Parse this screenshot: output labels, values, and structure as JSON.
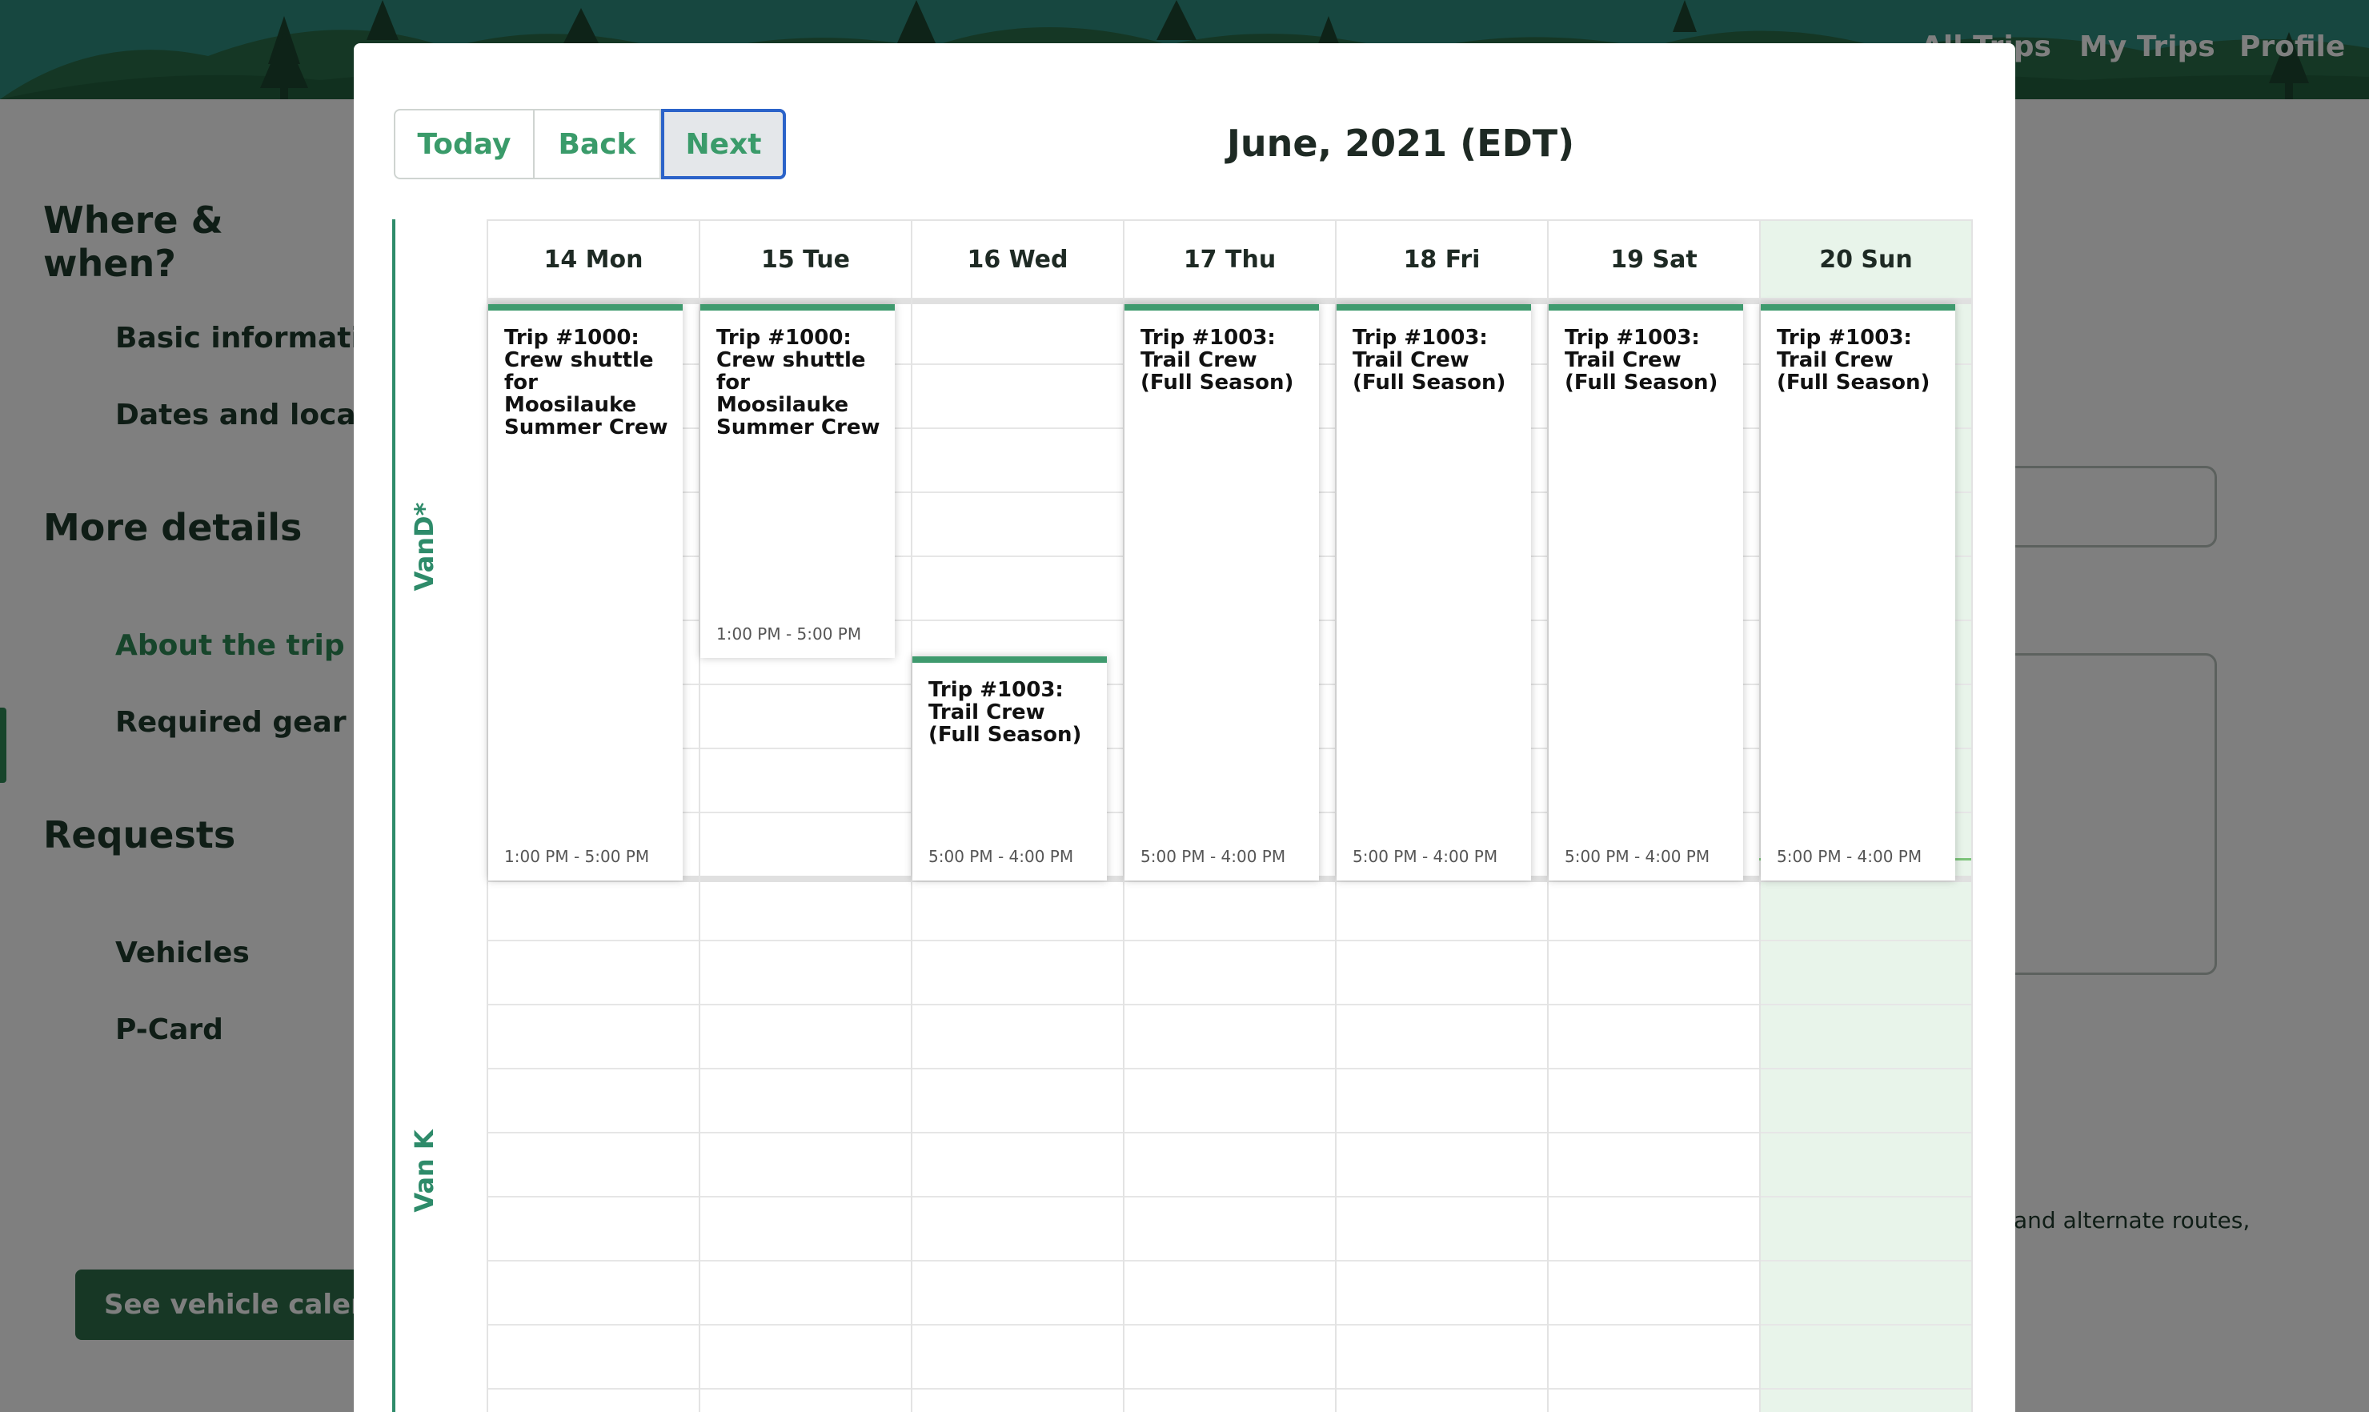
{
  "nav": {
    "items": [
      "All Trips",
      "My Trips",
      "Profile"
    ]
  },
  "sidebar": {
    "sections": [
      {
        "title": "Where & when?",
        "items": [
          "Basic information",
          "Dates and location"
        ]
      },
      {
        "title": "More details",
        "items": [
          "About the trip",
          "Required gear"
        ]
      },
      {
        "title": "Requests",
        "items": [
          "Vehicles",
          "P-Card"
        ]
      }
    ],
    "active_item": "About the trip",
    "vehicle_calendar_button": "See vehicle calendar"
  },
  "form": {
    "hint_text": "and alternate routes,"
  },
  "modal": {
    "toolbar": {
      "today": "Today",
      "back": "Back",
      "next": "Next"
    },
    "title": "June, 2021 (EDT)",
    "days": [
      "14 Mon",
      "15 Tue",
      "16 Wed",
      "17 Thu",
      "18 Fri",
      "19 Sat",
      "20 Sun"
    ],
    "today_index": 6,
    "resources": [
      "VanD*",
      "Van K"
    ],
    "events": [
      {
        "resource": 0,
        "day": 0,
        "title": "Trip #1000: Crew shuttle for Moosilauke Summer Crew",
        "time": "1:00 PM - 5:00 PM"
      },
      {
        "resource": 0,
        "day": 1,
        "title": "Trip #1000: Crew shuttle for Moosilauke Summer Crew",
        "time": "1:00 PM - 5:00 PM"
      },
      {
        "resource": 0,
        "day": 2,
        "title": "Trip #1003: Trail Crew (Full Season)",
        "time": "5:00 PM - 4:00 PM"
      },
      {
        "resource": 0,
        "day": 3,
        "title": "Trip #1003: Trail Crew (Full Season)",
        "time": "5:00 PM - 4:00 PM"
      },
      {
        "resource": 0,
        "day": 4,
        "title": "Trip #1003: Trail Crew (Full Season)",
        "time": "5:00 PM - 4:00 PM"
      },
      {
        "resource": 0,
        "day": 5,
        "title": "Trip #1003: Trail Crew (Full Season)",
        "time": "5:00 PM - 4:00 PM"
      },
      {
        "resource": 0,
        "day": 6,
        "title": "Trip #1003: Trail Crew (Full Season)",
        "time": "5:00 PM - 4:00 PM"
      }
    ]
  },
  "colors": {
    "accent": "#2e8b6a",
    "event_bar": "#3f9a6e",
    "today_bg": "#e8f4ea",
    "focus_ring": "#2b63c9"
  }
}
